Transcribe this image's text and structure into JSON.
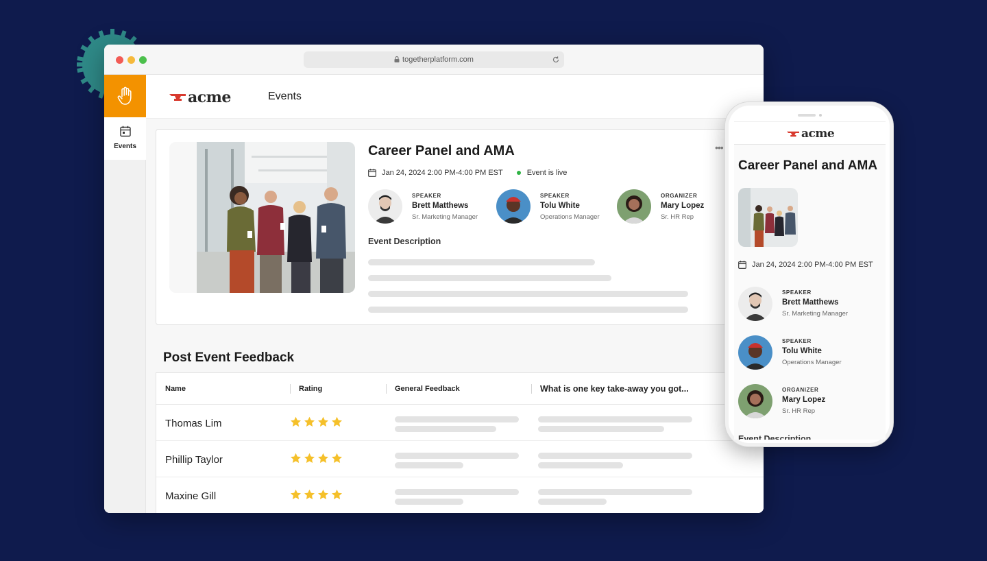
{
  "browser": {
    "url": "togetherplatform.com"
  },
  "sidebar": {
    "brand_icon": "raised-hand-icon",
    "items": [
      {
        "label": "Events",
        "icon": "calendar-icon"
      }
    ]
  },
  "header": {
    "logo_text": "acme",
    "page_title": "Events"
  },
  "event": {
    "title": "Career Panel and AMA",
    "more_icon": "more-dots-icon",
    "date": "Jan 24, 2024 2:00 PM-4:00 PM EST",
    "live_status": "Event is live",
    "people": [
      {
        "role": "SPEAKER",
        "name": "Brett Matthews",
        "title": "Sr. Marketing Manager"
      },
      {
        "role": "SPEAKER",
        "name": "Tolu White",
        "title": "Operations Manager"
      },
      {
        "role": "ORGANIZER",
        "name": "Mary Lopez",
        "title": "Sr. HR Rep"
      }
    ],
    "description_label": "Event Description"
  },
  "feedback": {
    "title": "Post Event Feedback",
    "columns": [
      "Name",
      "Rating",
      "General Feedback",
      "What is one key take-away you got..."
    ],
    "rows": [
      {
        "name": "Thomas Lim",
        "rating": 4
      },
      {
        "name": "Phillip Taylor",
        "rating": 4
      },
      {
        "name": "Maxine Gill",
        "rating": 4
      }
    ]
  },
  "phone": {
    "logo_text": "acme",
    "title": "Career Panel and AMA",
    "date": "Jan 24, 2024 2:00 PM-4:00 PM EST",
    "people": [
      {
        "role": "SPEAKER",
        "name": "Brett Matthews",
        "title": "Sr. Marketing Manager"
      },
      {
        "role": "SPEAKER",
        "name": "Tolu White",
        "title": "Operations Manager"
      },
      {
        "role": "ORGANIZER",
        "name": "Mary Lopez",
        "title": "Sr. HR Rep"
      }
    ],
    "cut_label": "Event Description"
  },
  "colors": {
    "background": "#0f1b4d",
    "brand_orange": "#f39200",
    "live_green": "#2fb344",
    "star_gold": "#f5c02a",
    "logo_red": "#d83a2e"
  }
}
